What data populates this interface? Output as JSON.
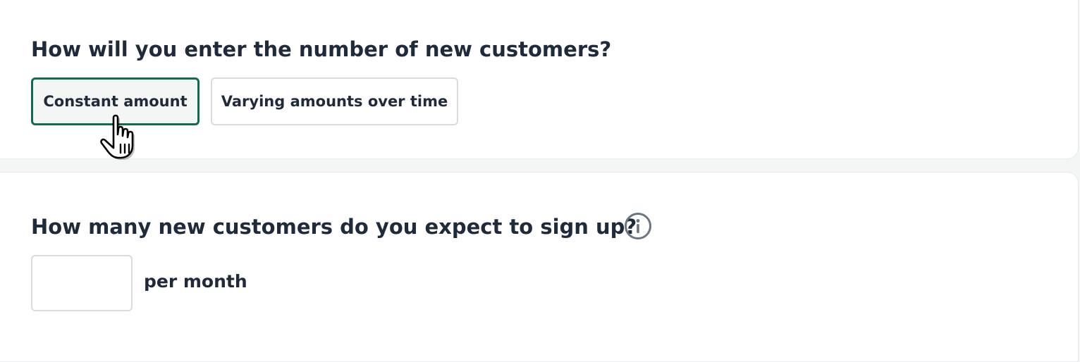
{
  "entry_method": {
    "question": "How will you enter the number of new customers?",
    "options": [
      {
        "label": "Constant amount",
        "selected": true
      },
      {
        "label": "Varying amounts over time",
        "selected": false
      }
    ]
  },
  "signups": {
    "question": "How many new customers do you expect to sign up?",
    "info_icon": "info-icon",
    "input_value": "",
    "unit_label": "per month"
  },
  "colors": {
    "accent": "#116b52",
    "text": "#1f2a3a",
    "border": "#d8dbdf",
    "info_icon": "#6b7480"
  },
  "cursor_icon": "hand-pointer-icon"
}
